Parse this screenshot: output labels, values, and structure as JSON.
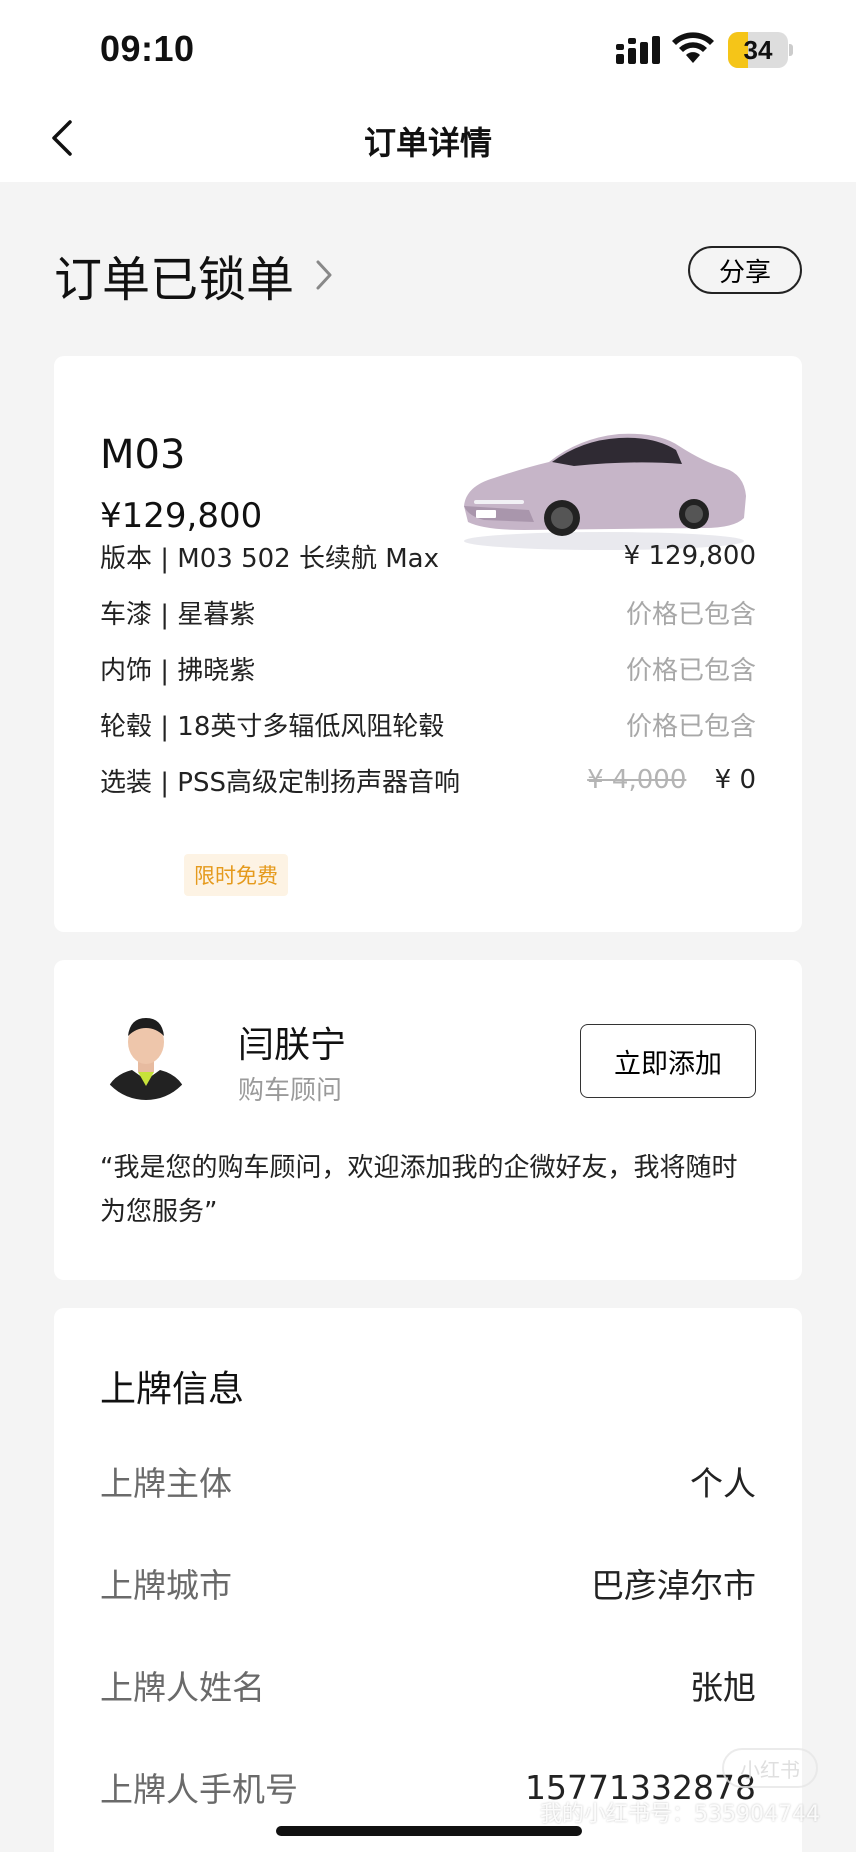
{
  "status_bar": {
    "time": "09:10",
    "battery": "34",
    "battery_level": 0.34
  },
  "nav": {
    "title": "订单详情",
    "back_icon": "chevron-left-icon"
  },
  "order": {
    "status": "订单已锁单",
    "share_label": "分享"
  },
  "car": {
    "model": "M03",
    "price": "¥129,800",
    "specs": [
      {
        "label": "版本 | M03 502 长续航 Max",
        "value": "¥ 129,800",
        "muted": false
      },
      {
        "label": "车漆 | 星暮紫",
        "value": "价格已包含",
        "muted": true
      },
      {
        "label": "内饰 | 拂晓紫",
        "value": "价格已包含",
        "muted": true
      },
      {
        "label": "轮毂 | 18英寸多辐低风阻轮毂",
        "value": "价格已包含",
        "muted": true
      },
      {
        "label": "选装 | PSS高级定制扬声器音响",
        "original_price": "¥ 4,000",
        "value": "¥ 0",
        "muted": false
      }
    ],
    "tag": "限时免费"
  },
  "advisor": {
    "name": "闫朕宁",
    "role": "购车顾问",
    "add_label": "立即添加",
    "quote": "“我是您的购车顾问，欢迎添加我的企微好友，我将随时为您服务”"
  },
  "plate": {
    "title": "上牌信息",
    "rows": [
      {
        "label": "上牌主体",
        "value": "个人"
      },
      {
        "label": "上牌城市",
        "value": "巴彦淖尔市"
      },
      {
        "label": "上牌人姓名",
        "value": "张旭"
      },
      {
        "label": "上牌人手机号",
        "value": "15771332878"
      }
    ]
  },
  "watermark": {
    "text": "我的小红书号：535904744",
    "logo": "小红书"
  }
}
